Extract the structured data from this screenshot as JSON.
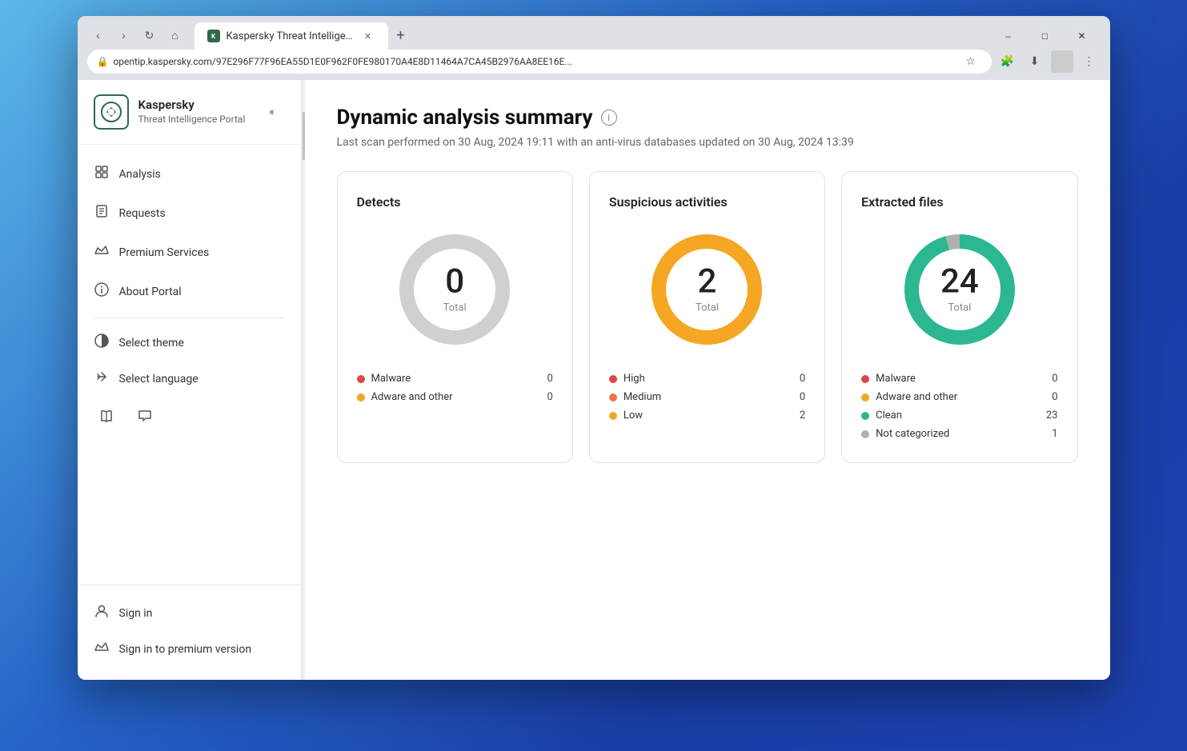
{
  "browser": {
    "tab_title": "Kaspersky Threat Intelligence P...",
    "url": "opentip.kaspersky.com/97E296F77F96EA55D1E0F962F0FE980170A4E8D11464A7CA45B2976AA8EE16E...",
    "new_tab_label": "+",
    "favicon_text": "K",
    "win_min": "–",
    "win_max": "□",
    "win_close": "✕"
  },
  "sidebar": {
    "brand_name": "Kaspersky",
    "brand_subtitle": "Threat Intelligence Portal",
    "collapse_icon": "«",
    "nav_items": [
      {
        "label": "Analysis",
        "icon": "📦"
      },
      {
        "label": "Requests",
        "icon": "📄"
      },
      {
        "label": "Premium Services",
        "icon": "👑"
      },
      {
        "label": "About Portal",
        "icon": "ℹ️"
      }
    ],
    "utility_items": [
      {
        "label": "Select theme",
        "icon": "🌗"
      },
      {
        "label": "Select language",
        "icon": "↔️"
      }
    ],
    "bottom_nav": [
      {
        "label": "Sign in",
        "icon": "👤"
      },
      {
        "label": "Sign in to premium version",
        "icon": "👑"
      }
    ],
    "icon_book": "📖",
    "icon_chat": "💬"
  },
  "main": {
    "title": "Dynamic analysis summary",
    "subtitle": "Last scan performed on 30 Aug, 2024 19:11 with an anti-virus databases updated on 30 Aug, 2024 13:39",
    "cards": [
      {
        "id": "detects",
        "title": "Detects",
        "total": "0",
        "total_label": "Total",
        "donut_color": "#b0b0b0",
        "donut_bg": "#e0e0e0",
        "legend": [
          {
            "label": "Malware",
            "count": "0",
            "color": "#e04444"
          },
          {
            "label": "Adware and other",
            "count": "0",
            "color": "#f5a623"
          }
        ]
      },
      {
        "id": "suspicious",
        "title": "Suspicious activities",
        "total": "2",
        "total_label": "Total",
        "donut_color": "#f5a623",
        "donut_bg": "#f0f0f0",
        "legend": [
          {
            "label": "High",
            "count": "0",
            "color": "#e04444"
          },
          {
            "label": "Medium",
            "count": "0",
            "color": "#f07050"
          },
          {
            "label": "Low",
            "count": "2",
            "color": "#f5a623"
          }
        ]
      },
      {
        "id": "extracted",
        "title": "Extracted files",
        "total": "24",
        "total_label": "Total",
        "donut_color": "#2bb890",
        "donut_bg": "#cccccc",
        "legend": [
          {
            "label": "Malware",
            "count": "0",
            "color": "#e04444"
          },
          {
            "label": "Adware and other",
            "count": "0",
            "color": "#f5a623"
          },
          {
            "label": "Clean",
            "count": "23",
            "color": "#2bb890"
          },
          {
            "label": "Not categorized",
            "count": "1",
            "color": "#b0b0b0"
          }
        ]
      }
    ]
  }
}
